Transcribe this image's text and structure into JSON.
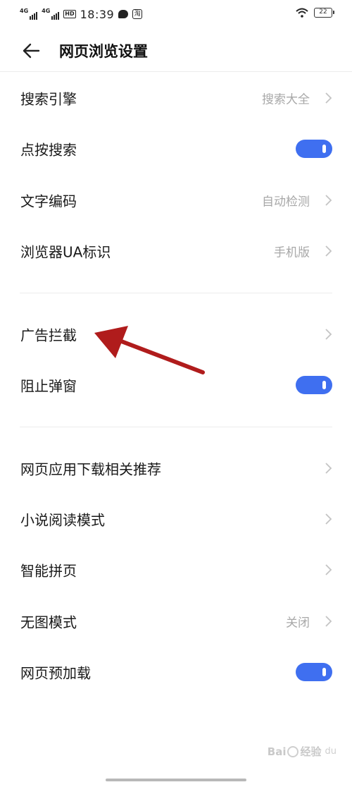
{
  "status_bar": {
    "sig1_label": "4G",
    "sig2_label": "4G",
    "hd_label": "HD",
    "time": "18:39",
    "taobao_glyph": "淘",
    "battery": "22",
    "icons": [
      "signal-icon",
      "hd-icon",
      "chat-bubble-icon",
      "app-notification-icon",
      "wifi-icon",
      "battery-icon"
    ]
  },
  "header": {
    "title": "网页浏览设置",
    "back_icon": "back-arrow-icon"
  },
  "settings": {
    "search_engine": {
      "label": "搜索引擎",
      "value": "搜索大全"
    },
    "tap_search": {
      "label": "点按搜索",
      "toggle_on": true
    },
    "text_encoding": {
      "label": "文字编码",
      "value": "自动检测"
    },
    "browser_ua": {
      "label": "浏览器UA标识",
      "value": "手机版"
    },
    "ad_block": {
      "label": "广告拦截"
    },
    "block_popups": {
      "label": "阻止弹窗",
      "toggle_on": true
    },
    "web_app_recommend": {
      "label": "网页应用下载相关推荐"
    },
    "novel_mode": {
      "label": "小说阅读模式"
    },
    "smart_page": {
      "label": "智能拼页"
    },
    "no_image_mode": {
      "label": "无图模式",
      "value": "关闭"
    },
    "preload": {
      "label": "网页预加载",
      "toggle_on": true
    }
  },
  "colors": {
    "toggle_on": "#3f6ff0",
    "annotation_arrow": "#b01c1c",
    "secondary_text": "#a8a8a8"
  },
  "watermark": {
    "brand": "Bai",
    "brand_end": "经验",
    "sub": "du"
  }
}
